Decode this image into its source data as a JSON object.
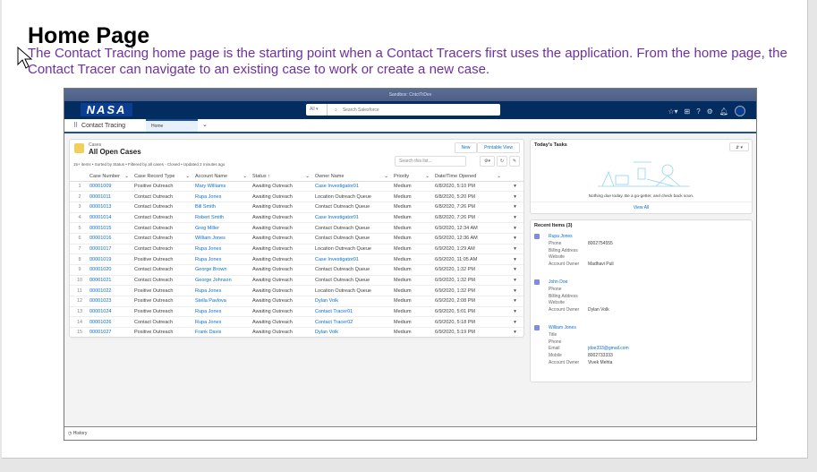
{
  "document": {
    "title": "Home Page",
    "body": "The Contact Tracing home page is the starting point when a Contact Tracers first uses the application. From the home page, the Contact Tracer can navigate to an existing case to work or create a new case."
  },
  "app": {
    "sandbox": "Sandbox: CntctTrDev",
    "logo": "NASA",
    "search_scope": "All",
    "search_placeholder": "Search Salesforce",
    "app_name": "Contact Tracing",
    "tab": "Home"
  },
  "cases": {
    "object": "Cases",
    "title": "All Open Cases",
    "meta": "15+ items • Sorted by Status • Filtered by all cases - Closed • Updated 2 minutes ago",
    "new": "New",
    "printable": "Printable View",
    "search_placeholder": "Search this list...",
    "columns": [
      "Case Number",
      "Case Record Type",
      "Account Name",
      "Status",
      "Owner Name",
      "Priority",
      "Date/Time Opened"
    ],
    "rows": [
      [
        "1",
        "00001009",
        "Positive Outreach",
        "Mary Williams",
        "Awaiting Outreach",
        "Case Investigator01",
        "Medium",
        "6/8/2020, 5:10 PM"
      ],
      [
        "2",
        "00001011",
        "Contact Outreach",
        "Rupa Jones",
        "Awaiting Outreach",
        "Location Outreach Queue",
        "Medium",
        "6/8/2020, 5:20 PM"
      ],
      [
        "3",
        "00001013",
        "Contact Outreach",
        "Bill Smith",
        "Awaiting Outreach",
        "Contact Outreach Queue",
        "Medium",
        "6/8/2020, 7:26 PM"
      ],
      [
        "4",
        "00001014",
        "Contact Outreach",
        "Robert Smith",
        "Awaiting Outreach",
        "Case Investigator01",
        "Medium",
        "6/8/2020, 7:26 PM"
      ],
      [
        "5",
        "00001015",
        "Contact Outreach",
        "Greg Miller",
        "Awaiting Outreach",
        "Contact Outreach Queue",
        "Medium",
        "6/9/2020, 12:34 AM"
      ],
      [
        "6",
        "00001016",
        "Contact Outreach",
        "William Jones",
        "Awaiting Outreach",
        "Contact Outreach Queue",
        "Medium",
        "6/9/2020, 12:36 AM"
      ],
      [
        "7",
        "00001017",
        "Contact Outreach",
        "Rupa Jones",
        "Awaiting Outreach",
        "Location Outreach Queue",
        "Medium",
        "6/9/2020, 1:29 AM"
      ],
      [
        "8",
        "00001019",
        "Positive Outreach",
        "Rupa Jones",
        "Awaiting Outreach",
        "Case Investigator01",
        "Medium",
        "6/9/2020, 11:05 AM"
      ],
      [
        "9",
        "00001020",
        "Contact Outreach",
        "George Brown",
        "Awaiting Outreach",
        "Contact Outreach Queue",
        "Medium",
        "6/9/2020, 1:32 PM"
      ],
      [
        "10",
        "00001021",
        "Contact Outreach",
        "George Johnson",
        "Awaiting Outreach",
        "Contact Outreach Queue",
        "Medium",
        "6/9/2020, 1:32 PM"
      ],
      [
        "11",
        "00001022",
        "Positive Outreach",
        "Rupa Jones",
        "Awaiting Outreach",
        "Location Outreach Queue",
        "Medium",
        "6/9/2020, 1:32 PM"
      ],
      [
        "12",
        "00001023",
        "Positive Outreach",
        "Stella Pavlova",
        "Awaiting Outreach",
        "Dylan Volk",
        "Medium",
        "6/9/2020, 2:08 PM"
      ],
      [
        "13",
        "00001024",
        "Positive Outreach",
        "Rupa Jones",
        "Awaiting Outreach",
        "Contact Tracer01",
        "Medium",
        "6/9/2020, 5:01 PM"
      ],
      [
        "14",
        "00001026",
        "Contact Outreach",
        "Rupa Jones",
        "Awaiting Outreach",
        "Contact Tracer02",
        "Medium",
        "6/9/2020, 5:18 PM"
      ],
      [
        "15",
        "00001027",
        "Positive Outreach",
        "Frank Davis",
        "Awaiting Outreach",
        "Dylan Volk",
        "Medium",
        "6/9/2020, 5:19 PM"
      ]
    ]
  },
  "tasks": {
    "title": "Today's Tasks",
    "empty": "Nothing due today. Be a go-getter, and check back soon.",
    "view_all": "View All"
  },
  "recent": {
    "title": "Recent Items (3)",
    "items": [
      {
        "name": "Rupa Jones",
        "fields": [
          [
            "Phone",
            "8002754555"
          ],
          [
            "Billing Address",
            ""
          ],
          [
            "Website",
            ""
          ],
          [
            "Account Owner",
            "Madhavi Puli"
          ]
        ]
      },
      {
        "name": "John Doe",
        "fields": [
          [
            "Phone",
            ""
          ],
          [
            "Billing Address",
            ""
          ],
          [
            "Website",
            ""
          ],
          [
            "Account Owner",
            "Dylan Volk"
          ]
        ]
      },
      {
        "name": "William Jones",
        "fields": [
          [
            "Title",
            ""
          ],
          [
            "Phone",
            ""
          ],
          [
            "Email",
            "jdoe333@gmail.com"
          ],
          [
            "Mobile",
            "8002733333"
          ],
          [
            "Account Owner",
            "Vivek Mehta"
          ]
        ]
      }
    ]
  },
  "footer": {
    "history": "History"
  },
  "colors": {
    "heading_text": "#7030a0",
    "nav": "#032d60",
    "link": "#0b6fd0"
  }
}
